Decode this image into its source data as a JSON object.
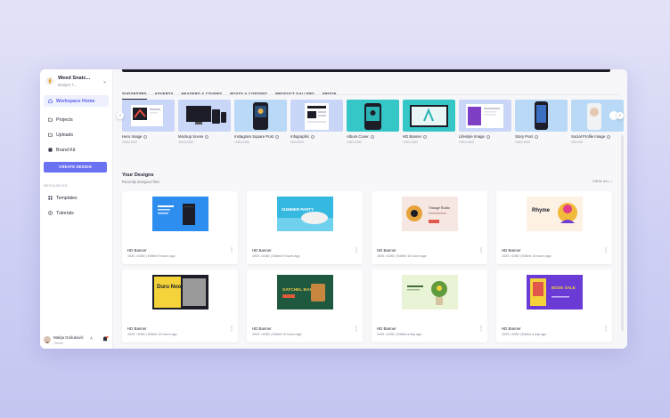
{
  "workspace": {
    "name": "Weed Snatc...",
    "subtitle": "Marija's T..."
  },
  "sidebar": {
    "nav": [
      {
        "label": "Workspace Home",
        "icon": "home-icon"
      },
      {
        "label": "Projects",
        "icon": "folder-icon"
      },
      {
        "label": "Uploads",
        "icon": "folder-icon"
      },
      {
        "label": "Brand Kit",
        "icon": "brand-icon"
      }
    ],
    "create_label": "CREATE DESIGN",
    "resources_title": "RESOURCES",
    "resources": [
      {
        "label": "Templates",
        "icon": "templates-icon"
      },
      {
        "label": "Tutorials",
        "icon": "tutorials-icon"
      }
    ],
    "user": {
      "name": "Marija Gošuković",
      "role": "Owner"
    }
  },
  "tabs": [
    "SUGGESTED",
    "ADVERTS",
    "HEADERS & COVERS",
    "POSTS & CONTENT",
    "PRODUCT GALLERY",
    "EBOOK"
  ],
  "templates": [
    {
      "name": "Hero Image",
      "dims": "2000×1500"
    },
    {
      "name": "Mockup Scene",
      "dims": "3000×2250"
    },
    {
      "name": "Instagram Square Post",
      "dims": "1080×1080"
    },
    {
      "name": "Infographic",
      "dims": "800×2000"
    },
    {
      "name": "Album Cover",
      "dims": "1080×1080"
    },
    {
      "name": "HD Banner",
      "dims": "1920×1080"
    },
    {
      "name": "Lifestyle Image",
      "dims": "2400×1600"
    },
    {
      "name": "Story Post",
      "dims": "1080×1920"
    },
    {
      "name": "Social Profile Image",
      "dims": "400×400"
    }
  ],
  "designs_section": {
    "title": "Your Designs",
    "subtitle": "Recently designed files",
    "view_all": "VIEW ALL ›"
  },
  "designs": [
    {
      "title": "HD Banner",
      "meta": "1920 ×1080 | Edited 9 hours ago"
    },
    {
      "title": "HD Banner",
      "meta": "1920 ×1080 | Edited 9 hours ago"
    },
    {
      "title": "HD Banner",
      "meta": "1920 ×1080 | Edited 10 hours ago"
    },
    {
      "title": "HD Banner",
      "meta": "1920 ×1080 | Edited 10 hours ago"
    },
    {
      "title": "HD Banner",
      "meta": "1920 ×1080 | Edited 10 hours ago"
    },
    {
      "title": "HD Banner",
      "meta": "1920 ×1080 | Edited 10 hours ago"
    },
    {
      "title": "HD Banner",
      "meta": "1920 ×1080 | Edited a day ago"
    },
    {
      "title": "HD Banner",
      "meta": "1920 ×1080 | Edited a day ago"
    }
  ],
  "thumb_texts": {
    "d2": "SUMMER PARTY",
    "d3": "Vintage Radio",
    "d4": "Rhyme",
    "d5": "Duru Noobs",
    "d6": "SATCHEL BAGS",
    "d8": "BOOK SALE"
  },
  "colors": {
    "accent": "#6b72f2",
    "tile_bg": "#c9d6f8",
    "sky": "#b9d9f6",
    "teal": "#35c6c7"
  }
}
